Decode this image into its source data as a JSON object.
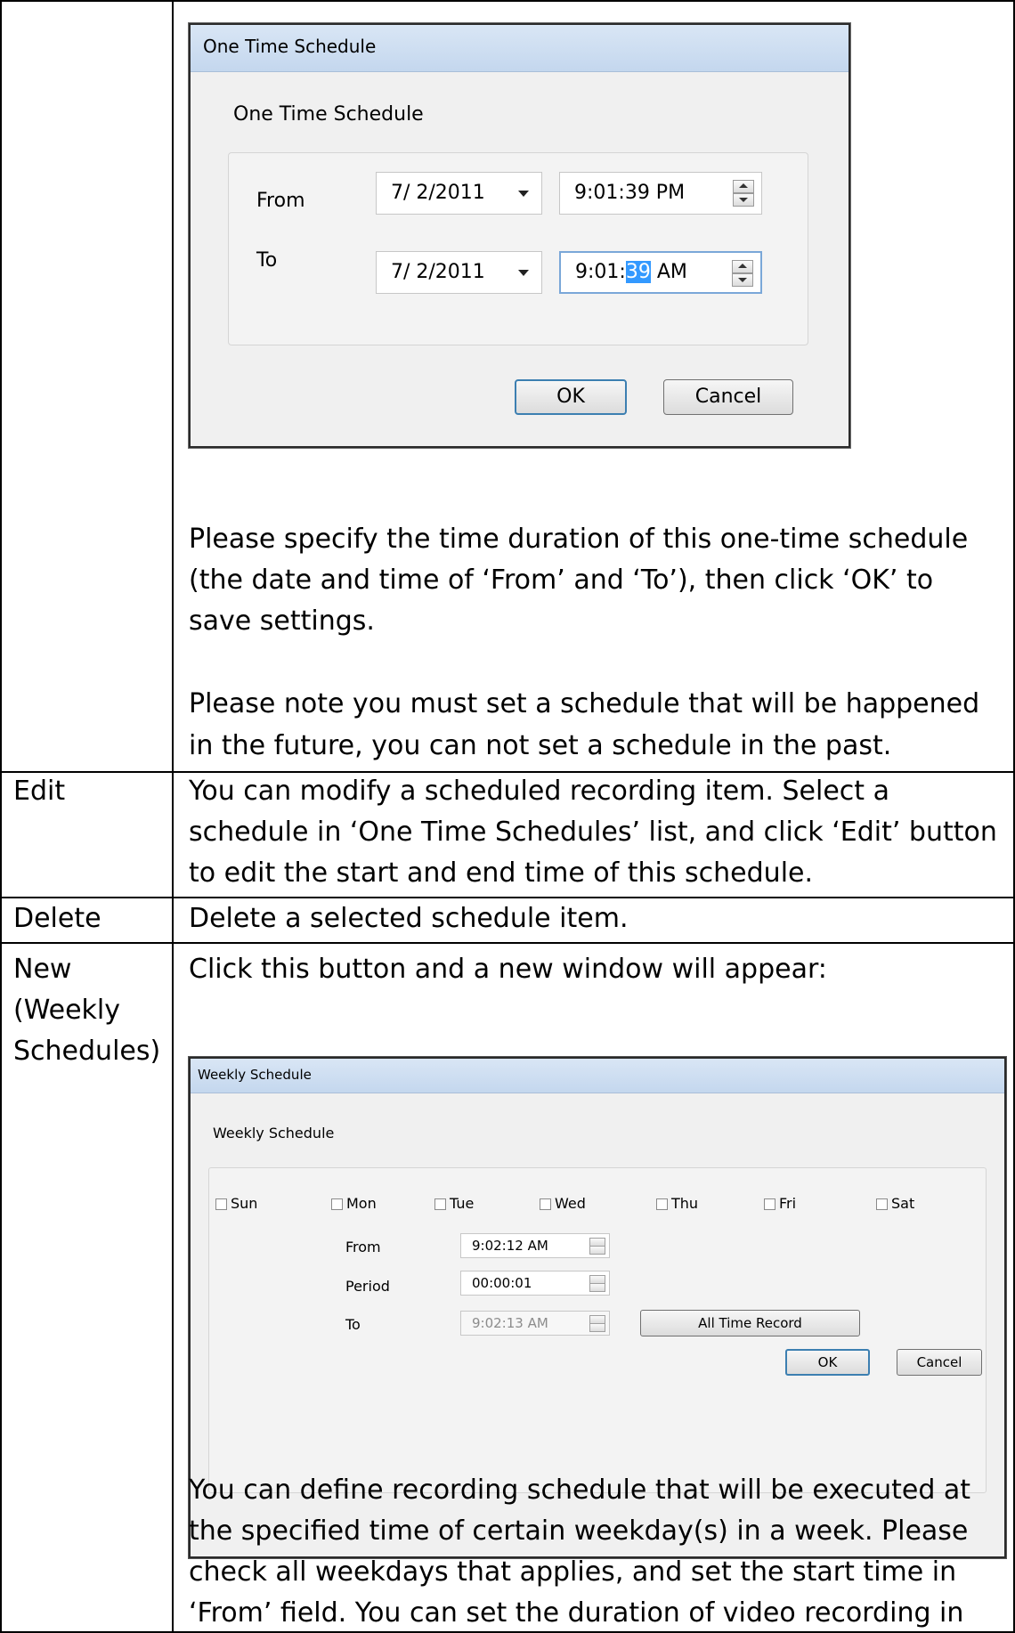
{
  "one_time_dialog": {
    "title": "One Time Schedule",
    "heading": "One Time Schedule",
    "from_label": "From",
    "to_label": "To",
    "from_date": "7/  2/2011",
    "to_date": "7/  2/2011",
    "from_time": "9:01:39 PM",
    "to_time_prefix": "9:01:",
    "to_time_selected": "39",
    "to_time_suffix": " AM",
    "ok": "OK",
    "cancel": "Cancel"
  },
  "paragraphs": {
    "p1_line1": "Please specify the time duration of this one-time schedule",
    "p1_line2": "(the date and time of ‘From’ and ‘To’), then click ‘OK’ to",
    "p1_line3": "save settings.",
    "p2_line1": "Please note you must set a schedule that will be happened",
    "p2_line2": "in the future, you can not set a schedule in the past."
  },
  "rows": {
    "edit": {
      "label": "Edit",
      "line1": "You can modify a scheduled recording item. Select a",
      "line2": "schedule in ‘One Time Schedules’ list, and click ‘Edit’ button",
      "line3": "to edit the start and end time of this schedule."
    },
    "delete": {
      "label": "Delete",
      "line1": "Delete a selected schedule item."
    },
    "new_weekly": {
      "label_line1": "New",
      "label_line2": "(Weekly",
      "label_line3": "Schedules)",
      "intro": "Click this button and a new window will appear:"
    }
  },
  "weekly_dialog": {
    "title": "Weekly Schedule",
    "heading": "Weekly Schedule",
    "days": [
      "Sun",
      "Mon",
      "Tue",
      "Wed",
      "Thu",
      "Fri",
      "Sat"
    ],
    "from_label": "From",
    "period_label": "Period",
    "to_label": "To",
    "from_time": "9:02:12 AM",
    "period": "00:00:01",
    "to_time": "9:02:13 AM",
    "all_time_record": "All Time Record",
    "ok": "OK",
    "cancel": "Cancel"
  },
  "final_paragraph": {
    "line1": "You can define recording schedule that will be executed at",
    "line2": "the specified time of certain weekday(s) in a week. Please",
    "line3": "check all weekdays that applies, and set the start time in",
    "line4": "‘From’ field. You can set the duration of video recording in"
  }
}
